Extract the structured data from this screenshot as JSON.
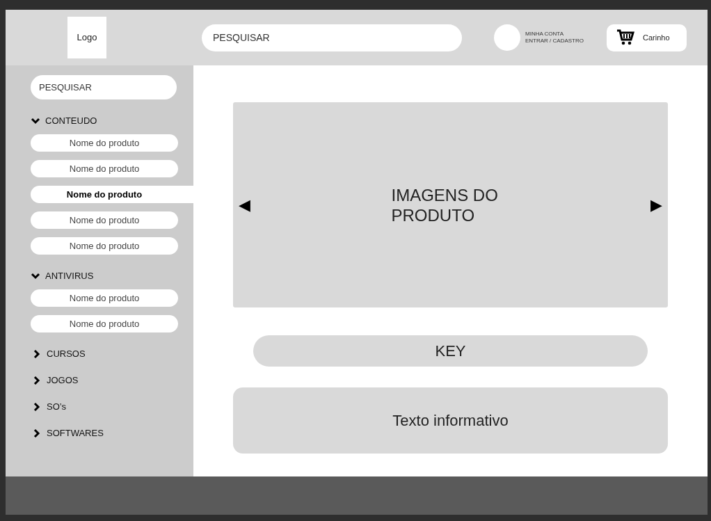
{
  "header": {
    "logo": "Logo",
    "search": {
      "placeholder": "PESQUISAR"
    },
    "account": {
      "line_1": "MINHA CONTA",
      "line_2": "ENTRAR / CADASTRO"
    },
    "cart": {
      "label": "Carinho"
    }
  },
  "sidebar": {
    "search": {
      "placeholder": "PESQUISAR"
    },
    "categories": [
      {
        "label": "CONTEUDO",
        "expanded": true,
        "children": [
          {
            "label": "Nome do produto",
            "selected": false
          },
          {
            "label": "Nome do produto",
            "selected": false
          },
          {
            "label": "Nome do produto",
            "selected": true
          },
          {
            "label": "Nome do produto",
            "selected": false
          },
          {
            "label": "Nome do produto",
            "selected": false
          }
        ]
      },
      {
        "label": "ANTIVIRUS",
        "expanded": true,
        "children": [
          {
            "label": "Nome do produto",
            "selected": false
          },
          {
            "label": "Nome do produto",
            "selected": false
          }
        ]
      },
      {
        "label": "CURSOS",
        "expanded": false
      },
      {
        "label": "JOGOS",
        "expanded": false
      },
      {
        "label": "SO’s",
        "expanded": false
      },
      {
        "label": "SOFTWARES",
        "expanded": false
      }
    ]
  },
  "product": {
    "gallery": {
      "label": "IMAGENS DO PRODUTO",
      "prev": "◀",
      "next": "▶"
    },
    "key": "KEY",
    "info": "Texto informativo"
  }
}
